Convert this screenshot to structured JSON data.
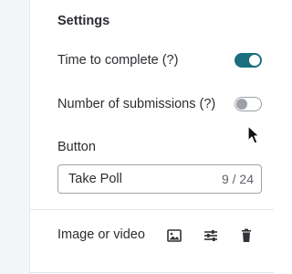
{
  "settings": {
    "title": "Settings",
    "time_to_complete": {
      "label": "Time to complete (?)",
      "enabled": true
    },
    "number_of_submissions": {
      "label": "Number of submissions (?)",
      "enabled": false
    },
    "button": {
      "label": "Button",
      "value": "Take Poll",
      "counter": "9 / 24"
    }
  },
  "media": {
    "label": "Image or video",
    "icons": [
      "image-icon",
      "sliders-icon",
      "trash-icon"
    ]
  },
  "colors": {
    "accent": "#1b6e7e",
    "toggle_off": "#9da1a7",
    "text": "#2b2d31"
  }
}
